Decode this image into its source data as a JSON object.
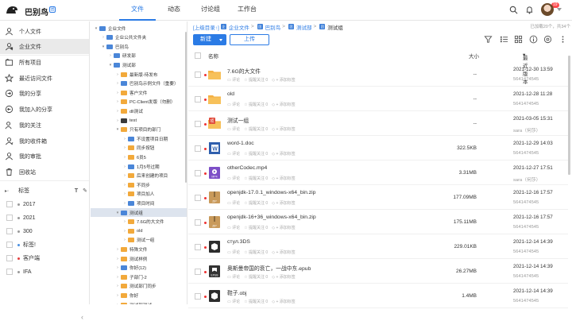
{
  "app": {
    "title": "巴别鸟",
    "badge": "团"
  },
  "nav": {
    "tabs": [
      "文件",
      "动态",
      "讨论组",
      "工作台"
    ],
    "active": 0
  },
  "header": {
    "notif_count": "19"
  },
  "sidebar": {
    "items": [
      {
        "label": "个人文件",
        "icon": "person-icon"
      },
      {
        "label": "企业文件",
        "icon": "company-icon"
      },
      {
        "label": "所有项目",
        "icon": "project-icon"
      },
      {
        "label": "最近访问文件",
        "icon": "clock-icon"
      },
      {
        "label": "我的分享",
        "icon": "share-icon"
      },
      {
        "label": "我加入的分享",
        "icon": "join-share-icon"
      },
      {
        "label": "我的关注",
        "icon": "star-user-icon"
      },
      {
        "label": "我的收件箱",
        "icon": "inbox-icon"
      },
      {
        "label": "我的审批",
        "icon": "approve-icon"
      },
      {
        "label": "回收站",
        "icon": "trash-icon"
      }
    ],
    "active": 1,
    "tags_label": "标签",
    "tags": [
      {
        "label": "2017",
        "color": "#999999"
      },
      {
        "label": "2021",
        "color": "#999999"
      },
      {
        "label": "300",
        "color": "#999999"
      },
      {
        "label": "标签!",
        "color": "#4a90e2"
      },
      {
        "label": "客户端",
        "color": "#e33e3e"
      },
      {
        "label": "IFA",
        "color": "#999999"
      }
    ]
  },
  "tree": {
    "items": [
      {
        "label": "企业文件",
        "depth": 0,
        "arrow": "▾",
        "icon": "blue"
      },
      {
        "label": "企业公共文件夹",
        "depth": 1,
        "arrow": "›",
        "icon": "blue"
      },
      {
        "label": "巴别鸟",
        "depth": 1,
        "arrow": "▾",
        "icon": "blue"
      },
      {
        "label": "研发部",
        "depth": 2,
        "arrow": "›",
        "icon": "blue"
      },
      {
        "label": "测试部",
        "depth": 2,
        "arrow": "▾",
        "icon": "blue"
      },
      {
        "label": "最新版-待发布",
        "depth": 3,
        "arrow": "›",
        "icon": "orange"
      },
      {
        "label": "巴别鸟示例文件（重要）",
        "depth": 3,
        "arrow": "›",
        "icon": "blue"
      },
      {
        "label": "客户文件",
        "depth": 3,
        "arrow": "›",
        "icon": "orange"
      },
      {
        "label": "PC-Client发版（勿删）",
        "depth": 3,
        "arrow": "›",
        "icon": "orange"
      },
      {
        "label": "dll测试",
        "depth": 3,
        "arrow": "›",
        "icon": "orange"
      },
      {
        "label": "test",
        "depth": 3,
        "arrow": "›",
        "icon": "dark"
      },
      {
        "label": "只有项目的部门",
        "depth": 3,
        "arrow": "▾",
        "icon": "orange"
      },
      {
        "label": "不设置项目日期",
        "depth": 4,
        "arrow": "›",
        "icon": "blue"
      },
      {
        "label": "同步按钮",
        "depth": 4,
        "arrow": "›",
        "icon": "orange"
      },
      {
        "label": "6员5",
        "depth": 4,
        "arrow": "›",
        "icon": "orange"
      },
      {
        "label": "1月5号过期",
        "depth": 4,
        "arrow": "›",
        "icon": "blue"
      },
      {
        "label": "后来创建的项目",
        "depth": 4,
        "arrow": "›",
        "icon": "orange"
      },
      {
        "label": "不同步",
        "depth": 4,
        "arrow": "›",
        "icon": "orange"
      },
      {
        "label": "项目加人",
        "depth": 4,
        "arrow": "›",
        "icon": "orange"
      },
      {
        "label": "项目时间",
        "depth": 4,
        "arrow": "›",
        "icon": "blue"
      },
      {
        "label": "测试组",
        "depth": 3,
        "arrow": "▾",
        "icon": "blue",
        "selected": true
      },
      {
        "label": "7.6G的大文件",
        "depth": 4,
        "arrow": "›",
        "icon": "orange"
      },
      {
        "label": "old",
        "depth": 4,
        "arrow": "›",
        "icon": "orange"
      },
      {
        "label": "测试一组",
        "depth": 4,
        "arrow": "›",
        "icon": "orange"
      },
      {
        "label": "特殊文件",
        "depth": 3,
        "arrow": "›",
        "icon": "orange"
      },
      {
        "label": "测试样例",
        "depth": 3,
        "arrow": "›",
        "icon": "orange"
      },
      {
        "label": "你好(12)",
        "depth": 3,
        "arrow": "›",
        "icon": "blue"
      },
      {
        "label": "子部门-2",
        "depth": 3,
        "arrow": "›",
        "icon": "orange"
      },
      {
        "label": "测试部门同步",
        "depth": 3,
        "arrow": "›",
        "icon": "orange"
      },
      {
        "label": "你好",
        "depth": 3,
        "arrow": "›",
        "icon": "orange"
      },
      {
        "label": "测试部测试",
        "depth": 3,
        "arrow": "›",
        "icon": "orange"
      }
    ]
  },
  "breadcrumb": {
    "up": "[上级目录↑]",
    "items": [
      "企业文件",
      "巴别鸟",
      "测试部",
      "测试组"
    ],
    "stats": "已加载20个，共34个"
  },
  "toolbar": {
    "new_label": "新建",
    "upload_label": "上传"
  },
  "columns": {
    "name": "名称",
    "size": "大小",
    "modified": "最近版本"
  },
  "row_actions": {
    "comment": "评论",
    "remind": "提醒关注 0",
    "tag": "+ 添加标签"
  },
  "files": [
    {
      "name": "7.6G的大文件",
      "type": "folder",
      "size": "--",
      "date": "2021-12-30 13:59",
      "user": "5641474545"
    },
    {
      "name": "old",
      "type": "folder",
      "size": "--",
      "date": "2021-12-28 11:28",
      "user": "5641474545"
    },
    {
      "name": "测试一组",
      "type": "project",
      "size": "--",
      "date": "2021-03-05 15:31",
      "user": "sara（何莎）"
    },
    {
      "name": "word-1.doc",
      "type": "word",
      "size": "322.5KB",
      "date": "2021-12-29 14:03",
      "user": "5641474545"
    },
    {
      "name": "otherCodec.mp4",
      "type": "video",
      "size": "3.31MB",
      "date": "2021-12-27 17:51",
      "user": "sara（何莎）"
    },
    {
      "name": "openjdk-17.0.1_windows-x64_bin.zip",
      "type": "zip",
      "size": "177.09MB",
      "date": "2021-12-16 17:57",
      "user": "5641474545"
    },
    {
      "name": "openjdk-16+36_windows-x64_bin.zip",
      "type": "zip",
      "size": "175.11MB",
      "date": "2021-12-16 17:57",
      "user": "5641474545"
    },
    {
      "name": "стул.3DS",
      "type": "3d",
      "size": "229.01KB",
      "date": "2021-12-14 14:39",
      "user": "5641474545"
    },
    {
      "name": "奥斯曼帝国的衰亡，一战中东.epub",
      "type": "epub",
      "size": "26.27MB",
      "date": "2021-12-14 14:39",
      "user": "5641474545"
    },
    {
      "name": "鞋子.obj",
      "type": "3d",
      "size": "1.4MB",
      "date": "2021-12-14 14:39",
      "user": "5641474545"
    }
  ]
}
